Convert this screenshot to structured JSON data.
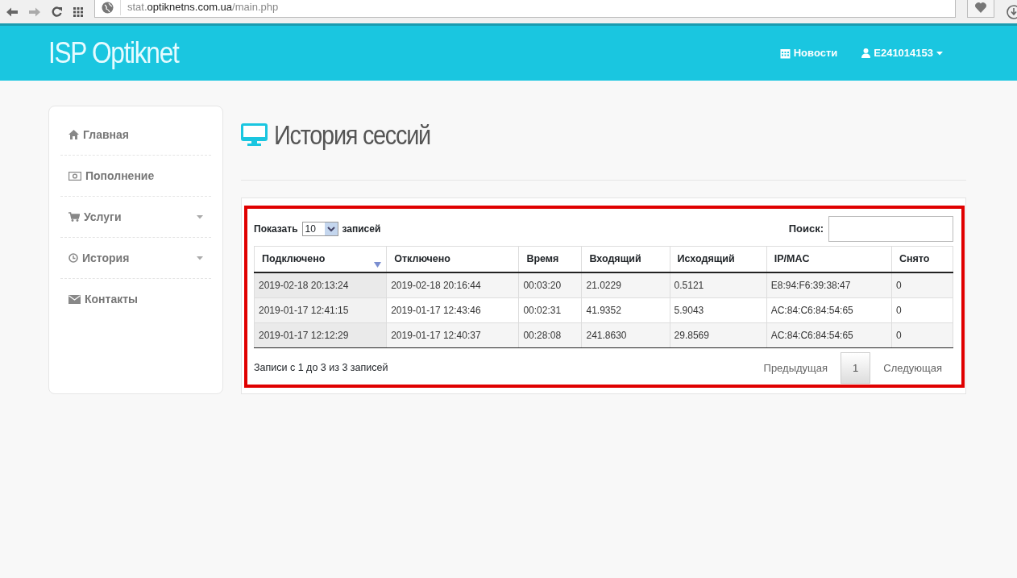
{
  "browser": {
    "url_prefix": "stat.",
    "url_domain": "optiknetns.com.ua",
    "url_path": "/main.php"
  },
  "navbar": {
    "brand": "ISP Optiknet",
    "links": [
      {
        "label": "Новости",
        "dropdown": false
      },
      {
        "label": "E241014153",
        "dropdown": true
      }
    ]
  },
  "sidebar": {
    "items": [
      {
        "label": "Главная",
        "has_submenu": false
      },
      {
        "label": "Пополнение",
        "has_submenu": false
      },
      {
        "label": "Услуги",
        "has_submenu": true
      },
      {
        "label": "История",
        "has_submenu": true
      },
      {
        "label": "Контакты",
        "has_submenu": false
      }
    ]
  },
  "page_title": "История сессий",
  "highlight_box": true,
  "table_controls": {
    "show_label": "Показать",
    "page_size": "10",
    "entries_label": "записей",
    "search_label": "Поиск:"
  },
  "table": {
    "columns": [
      {
        "label": "Подключено",
        "sorted": true
      },
      {
        "label": "Отключено",
        "sorted": false
      },
      {
        "label": "Время",
        "sorted": false
      },
      {
        "label": "Входящий",
        "sorted": false
      },
      {
        "label": "Исходящий",
        "sorted": false
      },
      {
        "label": "IP/MAC",
        "sorted": false
      },
      {
        "label": "Снято",
        "sorted": false
      }
    ],
    "rows": [
      [
        "2019-02-18 20:13:24",
        "2019-02-18 20:16:44",
        "00:03:20",
        "21.0229",
        "0.5121",
        "E8:94:F6:39:38:47",
        "0"
      ],
      [
        "2019-01-17 12:41:15",
        "2019-01-17 12:43:46",
        "00:02:31",
        "41.9352",
        "5.9043",
        "AC:84:C6:84:54:65",
        "0"
      ],
      [
        "2019-01-17 12:12:29",
        "2019-01-17 12:40:37",
        "00:28:08",
        "241.8630",
        "29.8569",
        "AC:84:C6:84:54:65",
        "0"
      ]
    ]
  },
  "info": "Записи с 1 до 3 из 3 записей",
  "pagination": {
    "previous": "Предыдущая",
    "pages": [
      {
        "label": "1",
        "selected": true
      }
    ],
    "next": "Следующая"
  }
}
